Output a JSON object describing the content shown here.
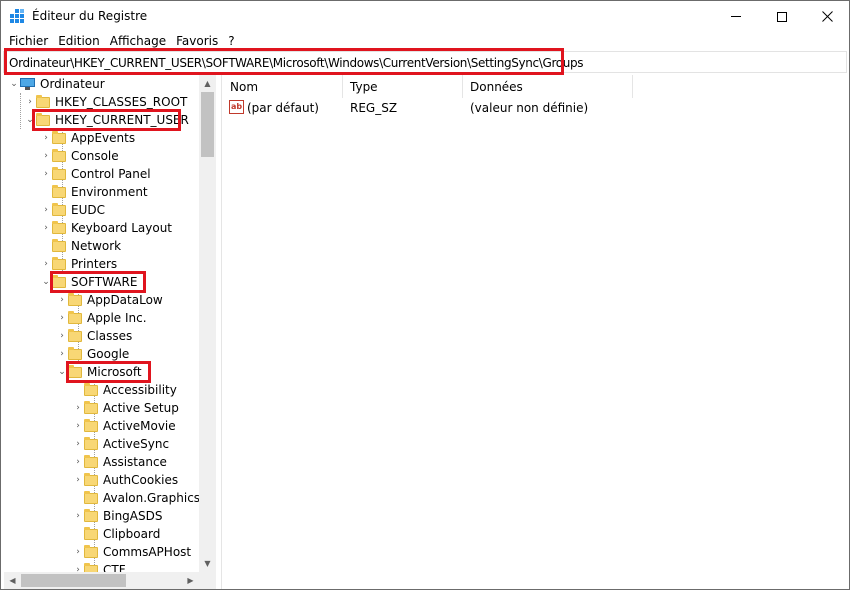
{
  "window": {
    "title": "Éditeur du Registre",
    "accent_colors": {
      "highlight_box": "#e0141e",
      "folder": "#f8d775",
      "computer_icon": "#4ea8e6"
    }
  },
  "menu": [
    {
      "label": "Fichier"
    },
    {
      "label": "Edition"
    },
    {
      "label": "Affichage"
    },
    {
      "label": "Favoris"
    },
    {
      "label": "?"
    }
  ],
  "address": {
    "path": "Ordinateur\\HKEY_CURRENT_USER\\SOFTWARE\\Microsoft\\Windows\\CurrentVersion\\SettingSync\\Groups"
  },
  "tree": {
    "root": {
      "label": "Ordinateur",
      "icon": "computer-icon",
      "expanded": true
    },
    "items": [
      {
        "label": "HKEY_CLASSES_ROOT",
        "expanded": false
      },
      {
        "label": "HKEY_CURRENT_USER",
        "expanded": true,
        "highlighted": true
      },
      {
        "label": "AppEvents",
        "expanded": false
      },
      {
        "label": "Console",
        "expanded": false
      },
      {
        "label": "Control Panel",
        "expanded": false
      },
      {
        "label": "Environment",
        "expanded": false
      },
      {
        "label": "EUDC",
        "expanded": false
      },
      {
        "label": "Keyboard Layout",
        "expanded": false
      },
      {
        "label": "Network",
        "expanded": false
      },
      {
        "label": "Printers",
        "expanded": false
      },
      {
        "label": "SOFTWARE",
        "expanded": true,
        "highlighted": true
      },
      {
        "label": "AppDataLow",
        "expanded": false
      },
      {
        "label": "Apple Inc.",
        "expanded": false
      },
      {
        "label": "Classes",
        "expanded": false
      },
      {
        "label": "Google",
        "expanded": false
      },
      {
        "label": "Microsoft",
        "expanded": true,
        "highlighted": true
      },
      {
        "label": "Accessibility",
        "expanded": false
      },
      {
        "label": "Active Setup",
        "expanded": false
      },
      {
        "label": "ActiveMovie",
        "expanded": false
      },
      {
        "label": "ActiveSync",
        "expanded": false
      },
      {
        "label": "Assistance",
        "expanded": false
      },
      {
        "label": "AuthCookies",
        "expanded": false
      },
      {
        "label": "Avalon.Graphics",
        "expanded": false
      },
      {
        "label": "BingASDS",
        "expanded": false
      },
      {
        "label": "Clipboard",
        "expanded": false
      },
      {
        "label": "CommsAPHost",
        "expanded": false
      },
      {
        "label": "CTF",
        "expanded": false
      }
    ]
  },
  "list": {
    "columns": {
      "name": "Nom",
      "type": "Type",
      "data": "Données"
    },
    "rows": [
      {
        "icon": "string-value-icon",
        "icon_text": "ab",
        "name": "(par défaut)",
        "type": "REG_SZ",
        "data": "(valeur non définie)"
      }
    ]
  }
}
